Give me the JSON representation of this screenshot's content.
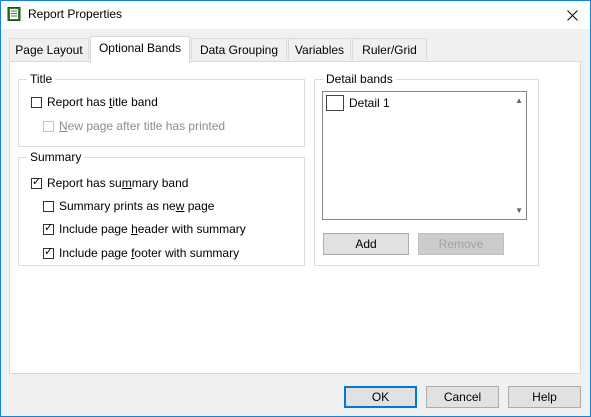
{
  "window": {
    "title": "Report Properties"
  },
  "tabs": [
    {
      "label": "Page Layout"
    },
    {
      "label": "Optional Bands"
    },
    {
      "label": "Data Grouping"
    },
    {
      "label": "Variables"
    },
    {
      "label": "Ruler/Grid"
    }
  ],
  "active_tab": "Optional Bands",
  "title_group": {
    "label": "Title",
    "has_title_band": {
      "label_pre": "Report has ",
      "label_u": "t",
      "label_post": "itle band",
      "checked": false
    },
    "new_page_after_title": {
      "label_pre": "",
      "label_u": "N",
      "label_post": "ew page after title has printed",
      "checked": false,
      "disabled": true
    }
  },
  "summary_group": {
    "label": "Summary",
    "has_summary_band": {
      "label_pre": "Report has su",
      "label_u": "m",
      "label_post": "mary band",
      "checked": true
    },
    "summary_new_page": {
      "label_pre": "Summary prints as ne",
      "label_u": "w",
      "label_post": " page",
      "checked": false
    },
    "include_header": {
      "label_pre": "Include page ",
      "label_u": "h",
      "label_post": "eader with summary",
      "checked": true
    },
    "include_footer": {
      "label_pre": "Include page ",
      "label_u": "f",
      "label_post": "ooter with summary",
      "checked": true
    }
  },
  "detail_bands": {
    "label": "Detail bands",
    "items": [
      {
        "label": "Detail 1"
      }
    ],
    "add_label": "Add",
    "remove_label": "Remove"
  },
  "footer": {
    "ok_label": "OK",
    "cancel_label": "Cancel",
    "help_label": "Help"
  }
}
